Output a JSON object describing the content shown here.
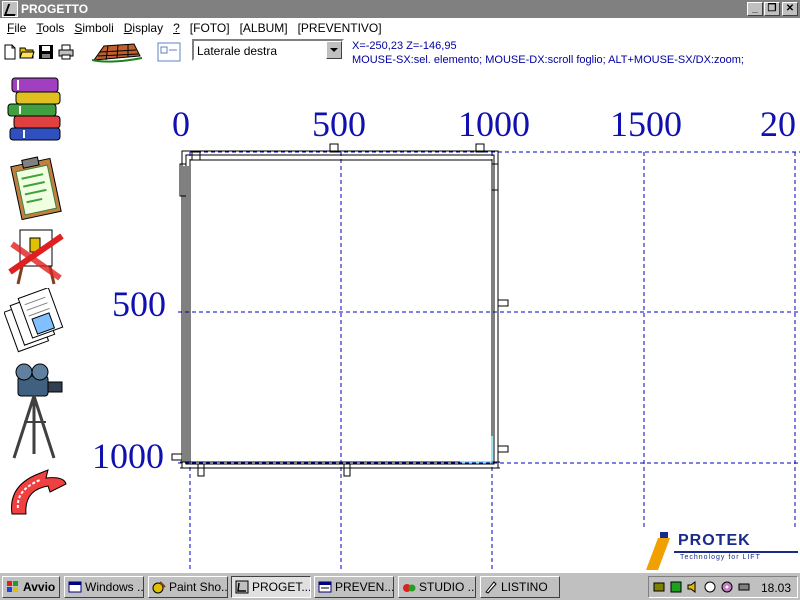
{
  "window": {
    "title": "PROGETTO"
  },
  "menu": [
    {
      "label": "File",
      "underline": "F"
    },
    {
      "label": "Tools",
      "underline": "T"
    },
    {
      "label": "Simboli",
      "underline": "S"
    },
    {
      "label": "Display",
      "underline": "D"
    },
    {
      "label": "?",
      "underline": "?"
    },
    {
      "label": "[FOTO]",
      "underline": ""
    },
    {
      "label": "[ALBUM]",
      "underline": ""
    },
    {
      "label": "[PREVENTIVO]",
      "underline": ""
    }
  ],
  "toolbar": {
    "view_select": "Laterale destra",
    "coords": "X=-250,23     Z=-146,95",
    "hint": "MOUSE-SX:sel. elemento; MOUSE-DX:scroll foglio; ALT+MOUSE-SX/DX:zoom;"
  },
  "ruler": {
    "top": [
      "0",
      "500",
      "1000",
      "1500",
      "20"
    ],
    "left": [
      "500",
      "1000"
    ]
  },
  "logo": {
    "brand": "PROTEK",
    "tagline": "Technology for LIFT"
  },
  "taskbar": {
    "start": "Avvio",
    "items": [
      "Windows ...",
      "Paint Sho...",
      "PROGET...",
      "PREVEN...",
      "STUDIO ...",
      "LISTINO"
    ],
    "clock": "18.03"
  },
  "colors": {
    "ruler": "#1010b0",
    "grid": "#0000c0",
    "titlebar": "#808080"
  }
}
